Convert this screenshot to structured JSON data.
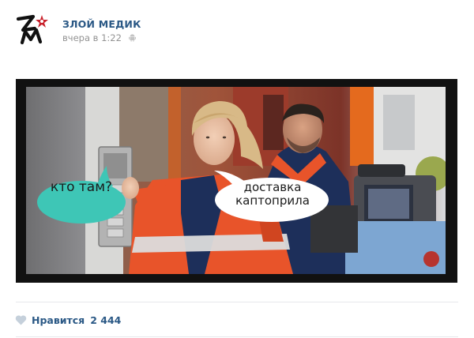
{
  "post": {
    "author": "ЗЛОЙ МЕДИК",
    "time": "вчера в 1:22",
    "platform_icon": "android-icon"
  },
  "image": {
    "bubbles": [
      {
        "text": "кто там?",
        "color": "#3ec6b6"
      },
      {
        "text": "доставка каптоприла",
        "color": "#ffffff"
      }
    ]
  },
  "footer": {
    "like_label": "Нравится",
    "like_count": "2 444",
    "like_icon": "heart-icon"
  },
  "colors": {
    "link": "#2a5885",
    "meta": "#939393",
    "uniform_orange": "#e8542a",
    "logo_red": "#c8202a"
  }
}
